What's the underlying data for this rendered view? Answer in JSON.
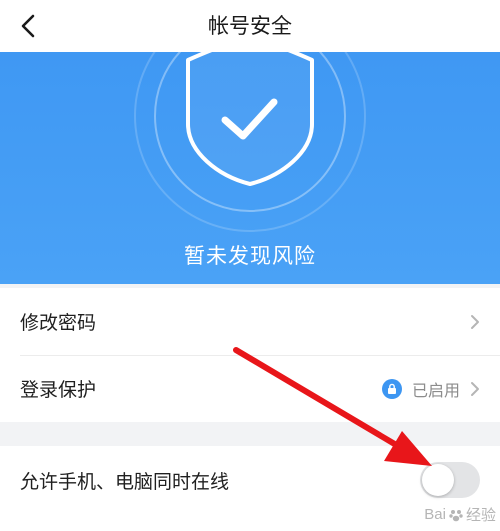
{
  "header": {
    "title": "帐号安全"
  },
  "hero": {
    "status_text": "暂未发现风险"
  },
  "security_items": [
    {
      "label": "修改密码"
    },
    {
      "label": "登录保护",
      "value": "已启用"
    }
  ],
  "online_setting": {
    "label": "允许手机、电脑同时在线",
    "toggle_on": false
  },
  "watermark": {
    "text": "Bai",
    "suffix": "经验"
  },
  "colors": {
    "accent": "#3f98f3",
    "annotation_arrow": "#e8161a",
    "toggle_off": "#e3e4e6"
  }
}
